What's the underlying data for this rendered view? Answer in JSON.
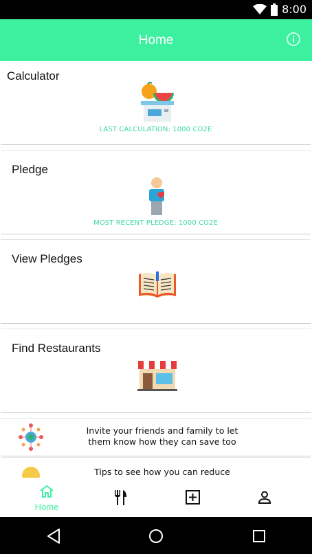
{
  "status_bar": {
    "time": "8:00",
    "icons": [
      "wifi-icon",
      "battery-icon"
    ]
  },
  "app_bar": {
    "title": "Home",
    "info_icon": "info-icon"
  },
  "cards": [
    {
      "title": "Calculator",
      "icon": "scale-fruit-icon",
      "caption": "LAST CALCULATION: 1000 CO2E"
    },
    {
      "title": "Pledge",
      "icon": "person-heart-icon",
      "caption": "MOST RECENT PLEDGE: 1000 CO2E"
    },
    {
      "title": "View Pledges",
      "icon": "open-book-icon",
      "caption": ""
    },
    {
      "title": "Find Restaurants",
      "icon": "restaurant-icon",
      "caption": ""
    }
  ],
  "rows": [
    {
      "icon": "network-people-icon",
      "text": "Invite your friends and family to let them know how they can save too"
    },
    {
      "icon": "lightbulb-icon",
      "text": "Tips to see how you can reduce"
    }
  ],
  "bottom_nav": [
    {
      "label": "Home",
      "icon": "home-icon",
      "active": true
    },
    {
      "label": "",
      "icon": "fork-knife-icon",
      "active": false
    },
    {
      "label": "",
      "icon": "add-box-icon",
      "active": false
    },
    {
      "label": "",
      "icon": "person-icon",
      "active": false
    }
  ],
  "system_nav": [
    "back-icon",
    "home-circle-icon",
    "recents-icon"
  ],
  "colors": {
    "accent": "#3cf0a0",
    "caption": "#3cd6a7",
    "divider": "#c9c9c9"
  }
}
